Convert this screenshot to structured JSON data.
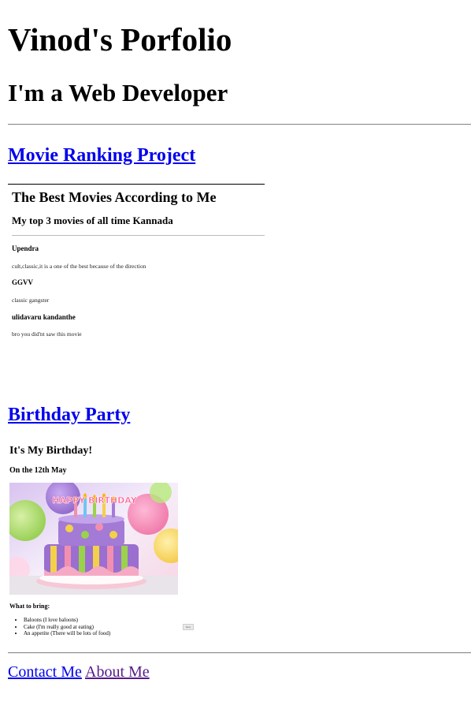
{
  "header": {
    "title": "Vinod's Porfolio",
    "subtitle": "I'm a Web Developer"
  },
  "projects": {
    "movie_link": "Movie Ranking Project",
    "birthday_link": "Birthday Party"
  },
  "movie": {
    "title": "The Best Movies According to Me",
    "subtitle": "My top 3 movies of all time Kannada",
    "items": [
      {
        "name": "Upendra",
        "desc": "cult,classic,it is a one of the best because of the direction"
      },
      {
        "name": "GGVV",
        "desc": "classic gangster"
      },
      {
        "name": "ulidavaru kandanthe",
        "desc": "bro you did'nt saw this movie"
      }
    ]
  },
  "birthday": {
    "heading": "It's My Birthday!",
    "date": "On the 12th May",
    "cake_text": "HAPPY BIRTHDAY",
    "bring_heading": "What to bring:",
    "bring_items": [
      "Baloons (I love baloons)",
      "Cake (I'm really good at eating)",
      "An appetite (There will be lots of food)"
    ],
    "button_label": "Rsvp"
  },
  "footer": {
    "contact": "Contact Me",
    "about": "About Me",
    "contact_color": "#0000ee",
    "about_color": "#551a8b"
  }
}
